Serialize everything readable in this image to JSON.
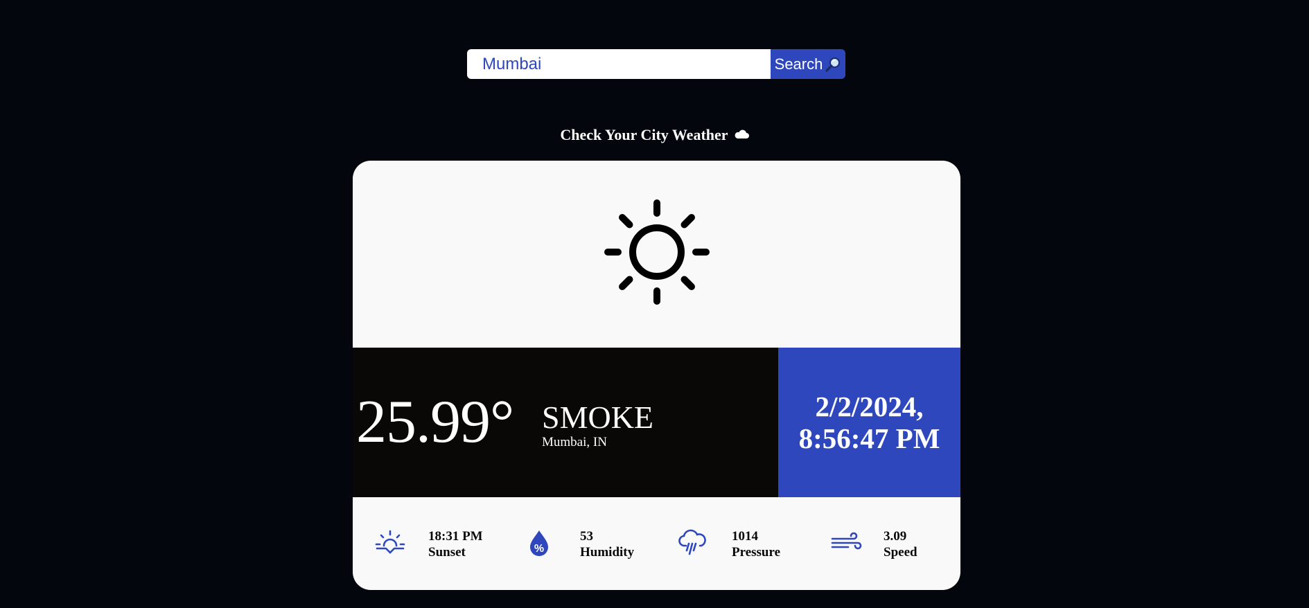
{
  "search": {
    "value": "Mumbai",
    "button_label": "Search",
    "button_icon": "magnifier-icon"
  },
  "heading": {
    "text": "Check Your City Weather",
    "icon": "cloud-icon"
  },
  "weather": {
    "icon": "sun-icon",
    "temperature": "25.99°",
    "condition": "SMOKE",
    "location": "Mumbai, IN",
    "date": "2/2/2024,",
    "time": "8:56:47 PM"
  },
  "stats": [
    {
      "icon": "sunset-icon",
      "value": "18:31 PM",
      "label": "Sunset"
    },
    {
      "icon": "humidity-icon",
      "value": "53",
      "label": "Humidity"
    },
    {
      "icon": "pressure-icon",
      "value": "1014",
      "label": "Pressure"
    },
    {
      "icon": "wind-icon",
      "value": "3.09",
      "label": "Speed"
    }
  ],
  "colors": {
    "background": "#03060d",
    "accent": "#2e47bd",
    "card": "#f9f9f9",
    "band_dark": "#0a0806"
  }
}
